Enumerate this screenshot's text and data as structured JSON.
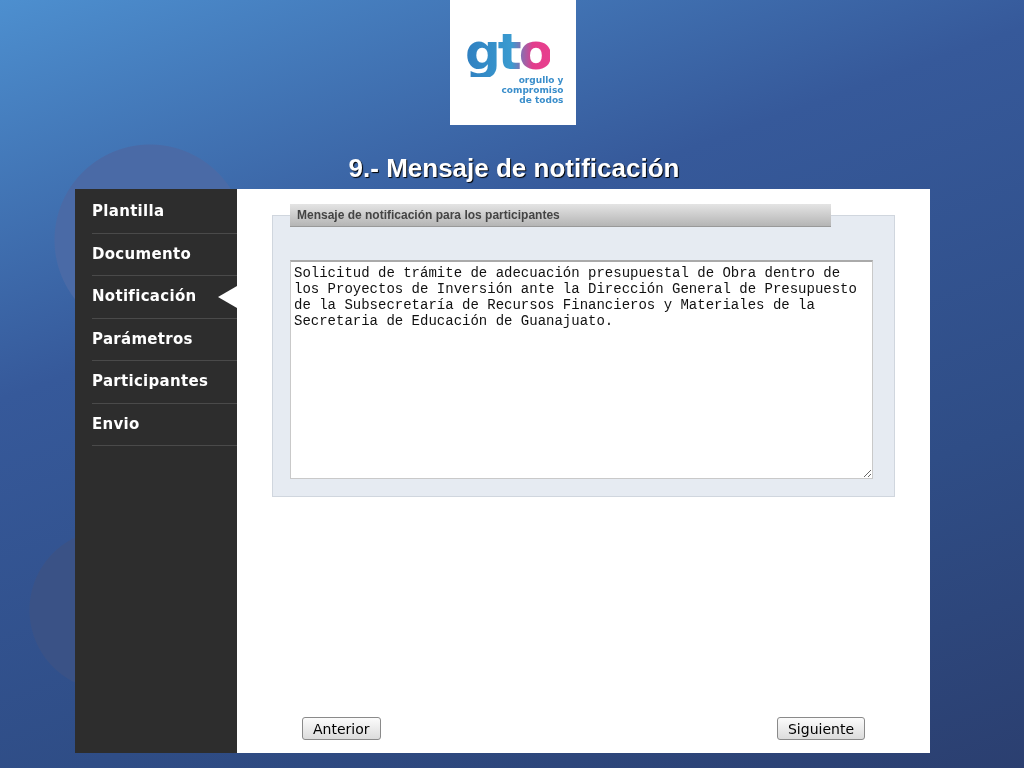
{
  "logo": {
    "mark": "gto",
    "tagline": [
      "orgullo y",
      "compromiso",
      "de todos"
    ]
  },
  "slide_title": "9.- Mensaje de notificación",
  "sidebar": {
    "items": [
      {
        "label": "Plantilla",
        "selected": false
      },
      {
        "label": "Documento",
        "selected": false
      },
      {
        "label": "Notificación",
        "selected": true
      },
      {
        "label": "Parámetros",
        "selected": false
      },
      {
        "label": "Participantes",
        "selected": false
      },
      {
        "label": "Envio",
        "selected": false
      }
    ]
  },
  "panel": {
    "title": "Mensaje de notificación para los participantes",
    "message": "Solicitud de trámite de adecuación presupuestal de Obra dentro de los Proyectos de Inversión ante la Dirección General de Presupuesto de la Subsecretaría de Recursos Financieros y Materiales de la Secretaria de Educación de Guanajuato."
  },
  "buttons": {
    "back": "Anterior",
    "next": "Siguiente"
  }
}
